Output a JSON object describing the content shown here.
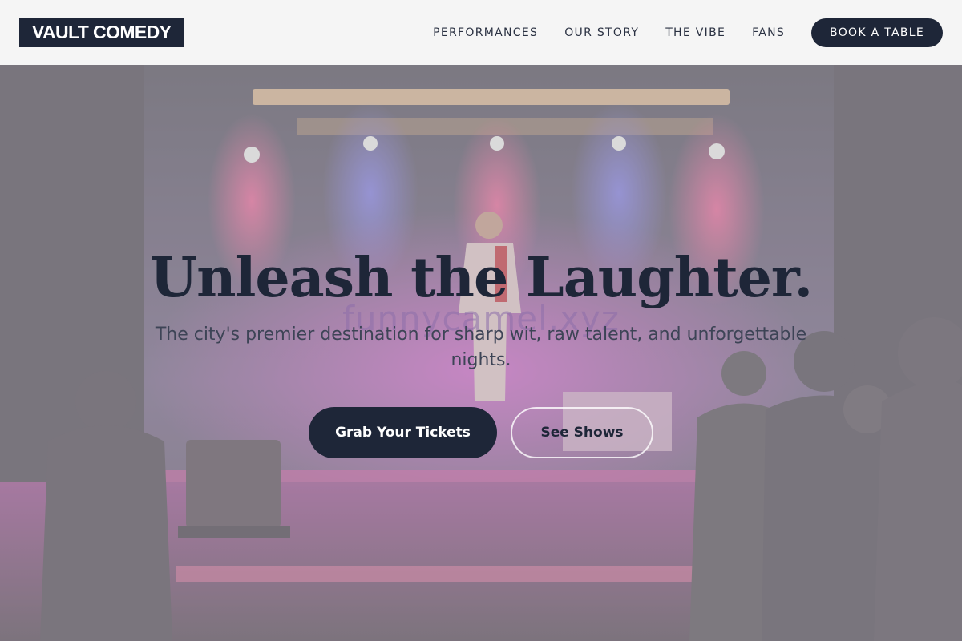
{
  "header": {
    "logo": "VAULT COMEDY",
    "nav": [
      "PERFORMANCES",
      "OUR STORY",
      "THE VIBE",
      "FANS"
    ],
    "cta": "BOOK A TABLE"
  },
  "hero": {
    "watermark": "funnycamel.xyz",
    "title": "Unleash the Laughter.",
    "subtitle": "The city's premier destination for sharp wit, raw talent, and unforgettable nights.",
    "primary_button": "Grab Your Tickets",
    "secondary_button": "See Shows",
    "background": "comedy-stage-photo"
  },
  "colors": {
    "brand_navy": "#1e2638",
    "header_bg": "#f5f5f5",
    "spotlight_pink": "#ff6fa0",
    "spotlight_blue": "#8f8cff"
  }
}
